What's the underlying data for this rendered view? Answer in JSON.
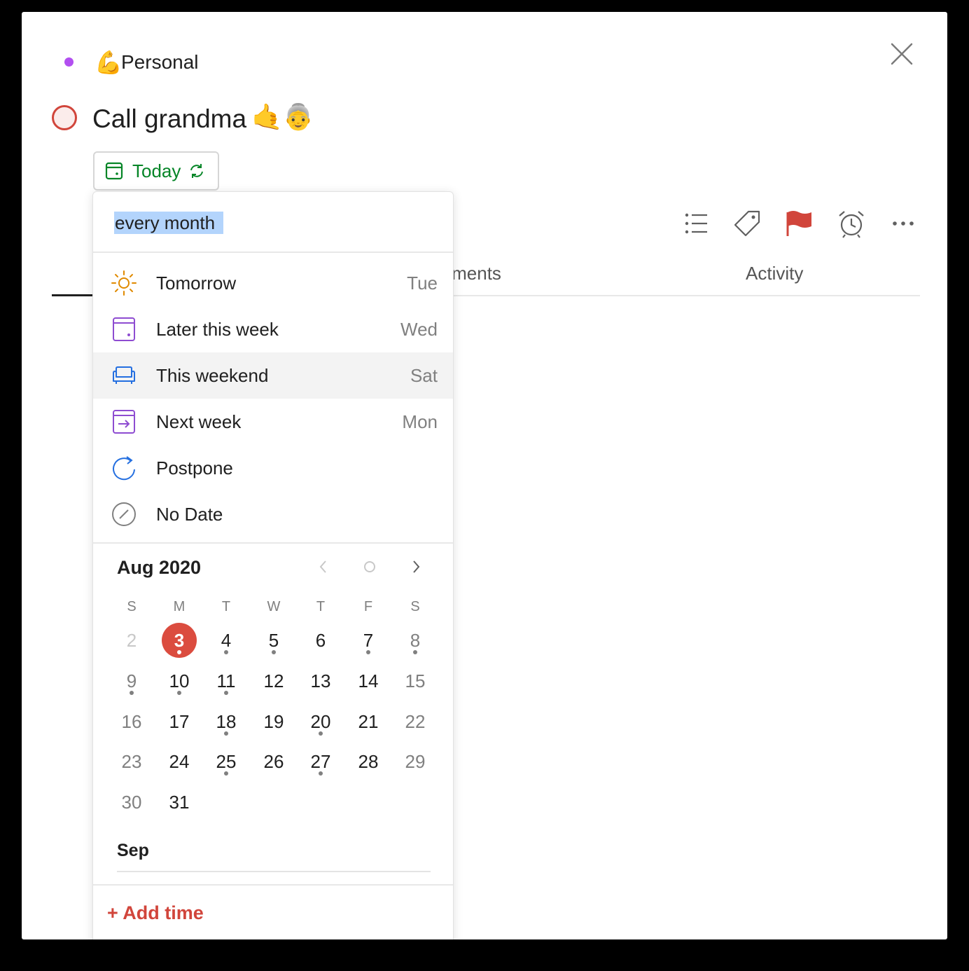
{
  "header": {
    "project_emoji": "💪",
    "project_name": "Personal",
    "project_color": "#b24ff0"
  },
  "task": {
    "title": "Call grandma",
    "title_emoji": "🤙👵",
    "priority_color": "#d1453b"
  },
  "due_button": {
    "label": "Today",
    "color": "#058527",
    "icons": [
      "calendar-icon",
      "repeat-icon"
    ]
  },
  "toolbar": {
    "icons": [
      "subtasks-icon",
      "label-icon",
      "priority-flag-icon",
      "reminder-alarm-icon",
      "more-icon"
    ],
    "flag_color": "#d1453b"
  },
  "tabs": {
    "comments": "omments",
    "activity": "Activity"
  },
  "scheduler": {
    "input_value": "every month",
    "options": [
      {
        "label": "Tomorrow",
        "day": "Tue",
        "icon": "sun-icon",
        "color": "#e08a00"
      },
      {
        "label": "Later this week",
        "day": "Wed",
        "icon": "calendar-week-icon",
        "color": "#8e4cd1"
      },
      {
        "label": "This weekend",
        "day": "Sat",
        "icon": "couch-icon",
        "color": "#246fe0"
      },
      {
        "label": "Next week",
        "day": "Mon",
        "icon": "arrow-right-box-icon",
        "color": "#8e4cd1"
      },
      {
        "label": "Postpone",
        "day": "",
        "icon": "postpone-arrow-icon",
        "color": "#246fe0"
      },
      {
        "label": "No Date",
        "day": "",
        "icon": "no-date-icon",
        "color": "#808080"
      }
    ],
    "calendar": {
      "month_title": "Aug 2020",
      "weekdays": [
        "S",
        "M",
        "T",
        "W",
        "T",
        "F",
        "S"
      ],
      "weeks": [
        [
          "2",
          "3",
          "4",
          "5",
          "6",
          "7",
          "8"
        ],
        [
          "9",
          "10",
          "11",
          "12",
          "13",
          "14",
          "15"
        ],
        [
          "16",
          "17",
          "18",
          "19",
          "20",
          "21",
          "22"
        ],
        [
          "23",
          "24",
          "25",
          "26",
          "27",
          "28",
          "29"
        ],
        [
          "30",
          "31",
          "",
          "",
          "",
          "",
          ""
        ]
      ],
      "today": "3",
      "dots": [
        "3",
        "4",
        "5",
        "7",
        "8",
        "9",
        "10",
        "11",
        "18",
        "20",
        "25",
        "27"
      ],
      "next_month": "Sep",
      "today_color": "#db4c3f"
    },
    "add_time": "+ Add time"
  }
}
